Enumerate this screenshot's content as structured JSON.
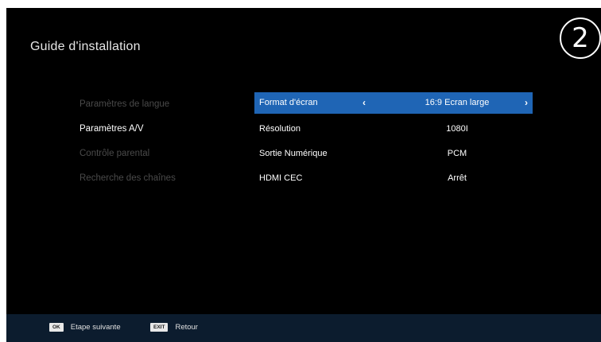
{
  "header": {
    "title": "Guide d'installation",
    "step": "2"
  },
  "left_menu": {
    "items": [
      {
        "label": "Paramètres de langue",
        "active": false
      },
      {
        "label": "Paramètres A/V",
        "active": true
      },
      {
        "label": "Contrôle parental",
        "active": false
      },
      {
        "label": "Recherche des chaînes",
        "active": false
      }
    ]
  },
  "settings": {
    "rows": [
      {
        "label": "Format d'écran",
        "value": "16:9 Ecran large",
        "selected": true,
        "left_arrow": "‹",
        "right_arrow": "›"
      },
      {
        "label": "Résolution",
        "value": "1080I",
        "selected": false
      },
      {
        "label": "Sortie Numérique",
        "value": "PCM",
        "selected": false
      },
      {
        "label": "HDMI CEC",
        "value": "Arrêt",
        "selected": false
      }
    ]
  },
  "footer": {
    "hints": [
      {
        "key": "OK",
        "label": "Etape suivante"
      },
      {
        "key": "EXIT",
        "label": "Retour"
      }
    ]
  },
  "colors": {
    "background": "#000000",
    "selection": "#1f65b5",
    "footer": "#0c1c2e",
    "inactive_text": "#4a4a4a"
  }
}
